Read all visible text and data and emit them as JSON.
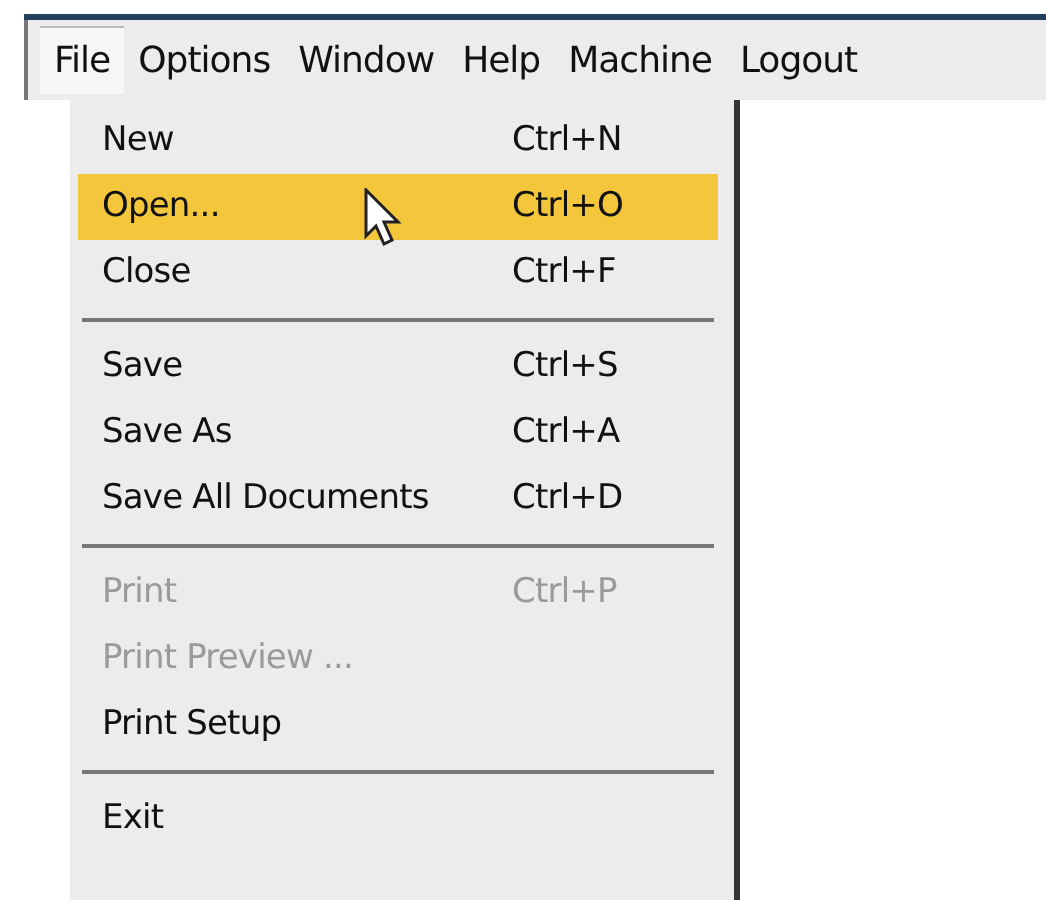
{
  "menubar": [
    {
      "label": "File",
      "selected": true
    },
    {
      "label": "Options",
      "selected": false
    },
    {
      "label": "Window",
      "selected": false
    },
    {
      "label": "Help",
      "selected": false
    },
    {
      "label": "Machine",
      "selected": false
    },
    {
      "label": "Logout",
      "selected": false
    }
  ],
  "menu": {
    "items": [
      {
        "kind": "item",
        "label": "New",
        "shortcut": "Ctrl+N",
        "disabled": false,
        "selected": false
      },
      {
        "kind": "item",
        "label": "Open...",
        "shortcut": "Ctrl+O",
        "disabled": false,
        "selected": true
      },
      {
        "kind": "item",
        "label": "Close",
        "shortcut": "Ctrl+F",
        "disabled": false,
        "selected": false
      },
      {
        "kind": "separator"
      },
      {
        "kind": "item",
        "label": "Save",
        "shortcut": "Ctrl+S",
        "disabled": false,
        "selected": false
      },
      {
        "kind": "item",
        "label": "Save As",
        "shortcut": "Ctrl+A",
        "disabled": false,
        "selected": false
      },
      {
        "kind": "item",
        "label": "Save All Documents",
        "shortcut": "Ctrl+D",
        "disabled": false,
        "selected": false
      },
      {
        "kind": "separator"
      },
      {
        "kind": "item",
        "label": "Print",
        "shortcut": "Ctrl+P",
        "disabled": true,
        "selected": false
      },
      {
        "kind": "item",
        "label": "Print Preview ...",
        "disabled": true,
        "selected": false
      },
      {
        "kind": "item",
        "label": "Print Setup",
        "disabled": false,
        "selected": false
      },
      {
        "kind": "separator"
      },
      {
        "kind": "item",
        "label": "Exit",
        "disabled": false,
        "selected": false
      }
    ]
  }
}
